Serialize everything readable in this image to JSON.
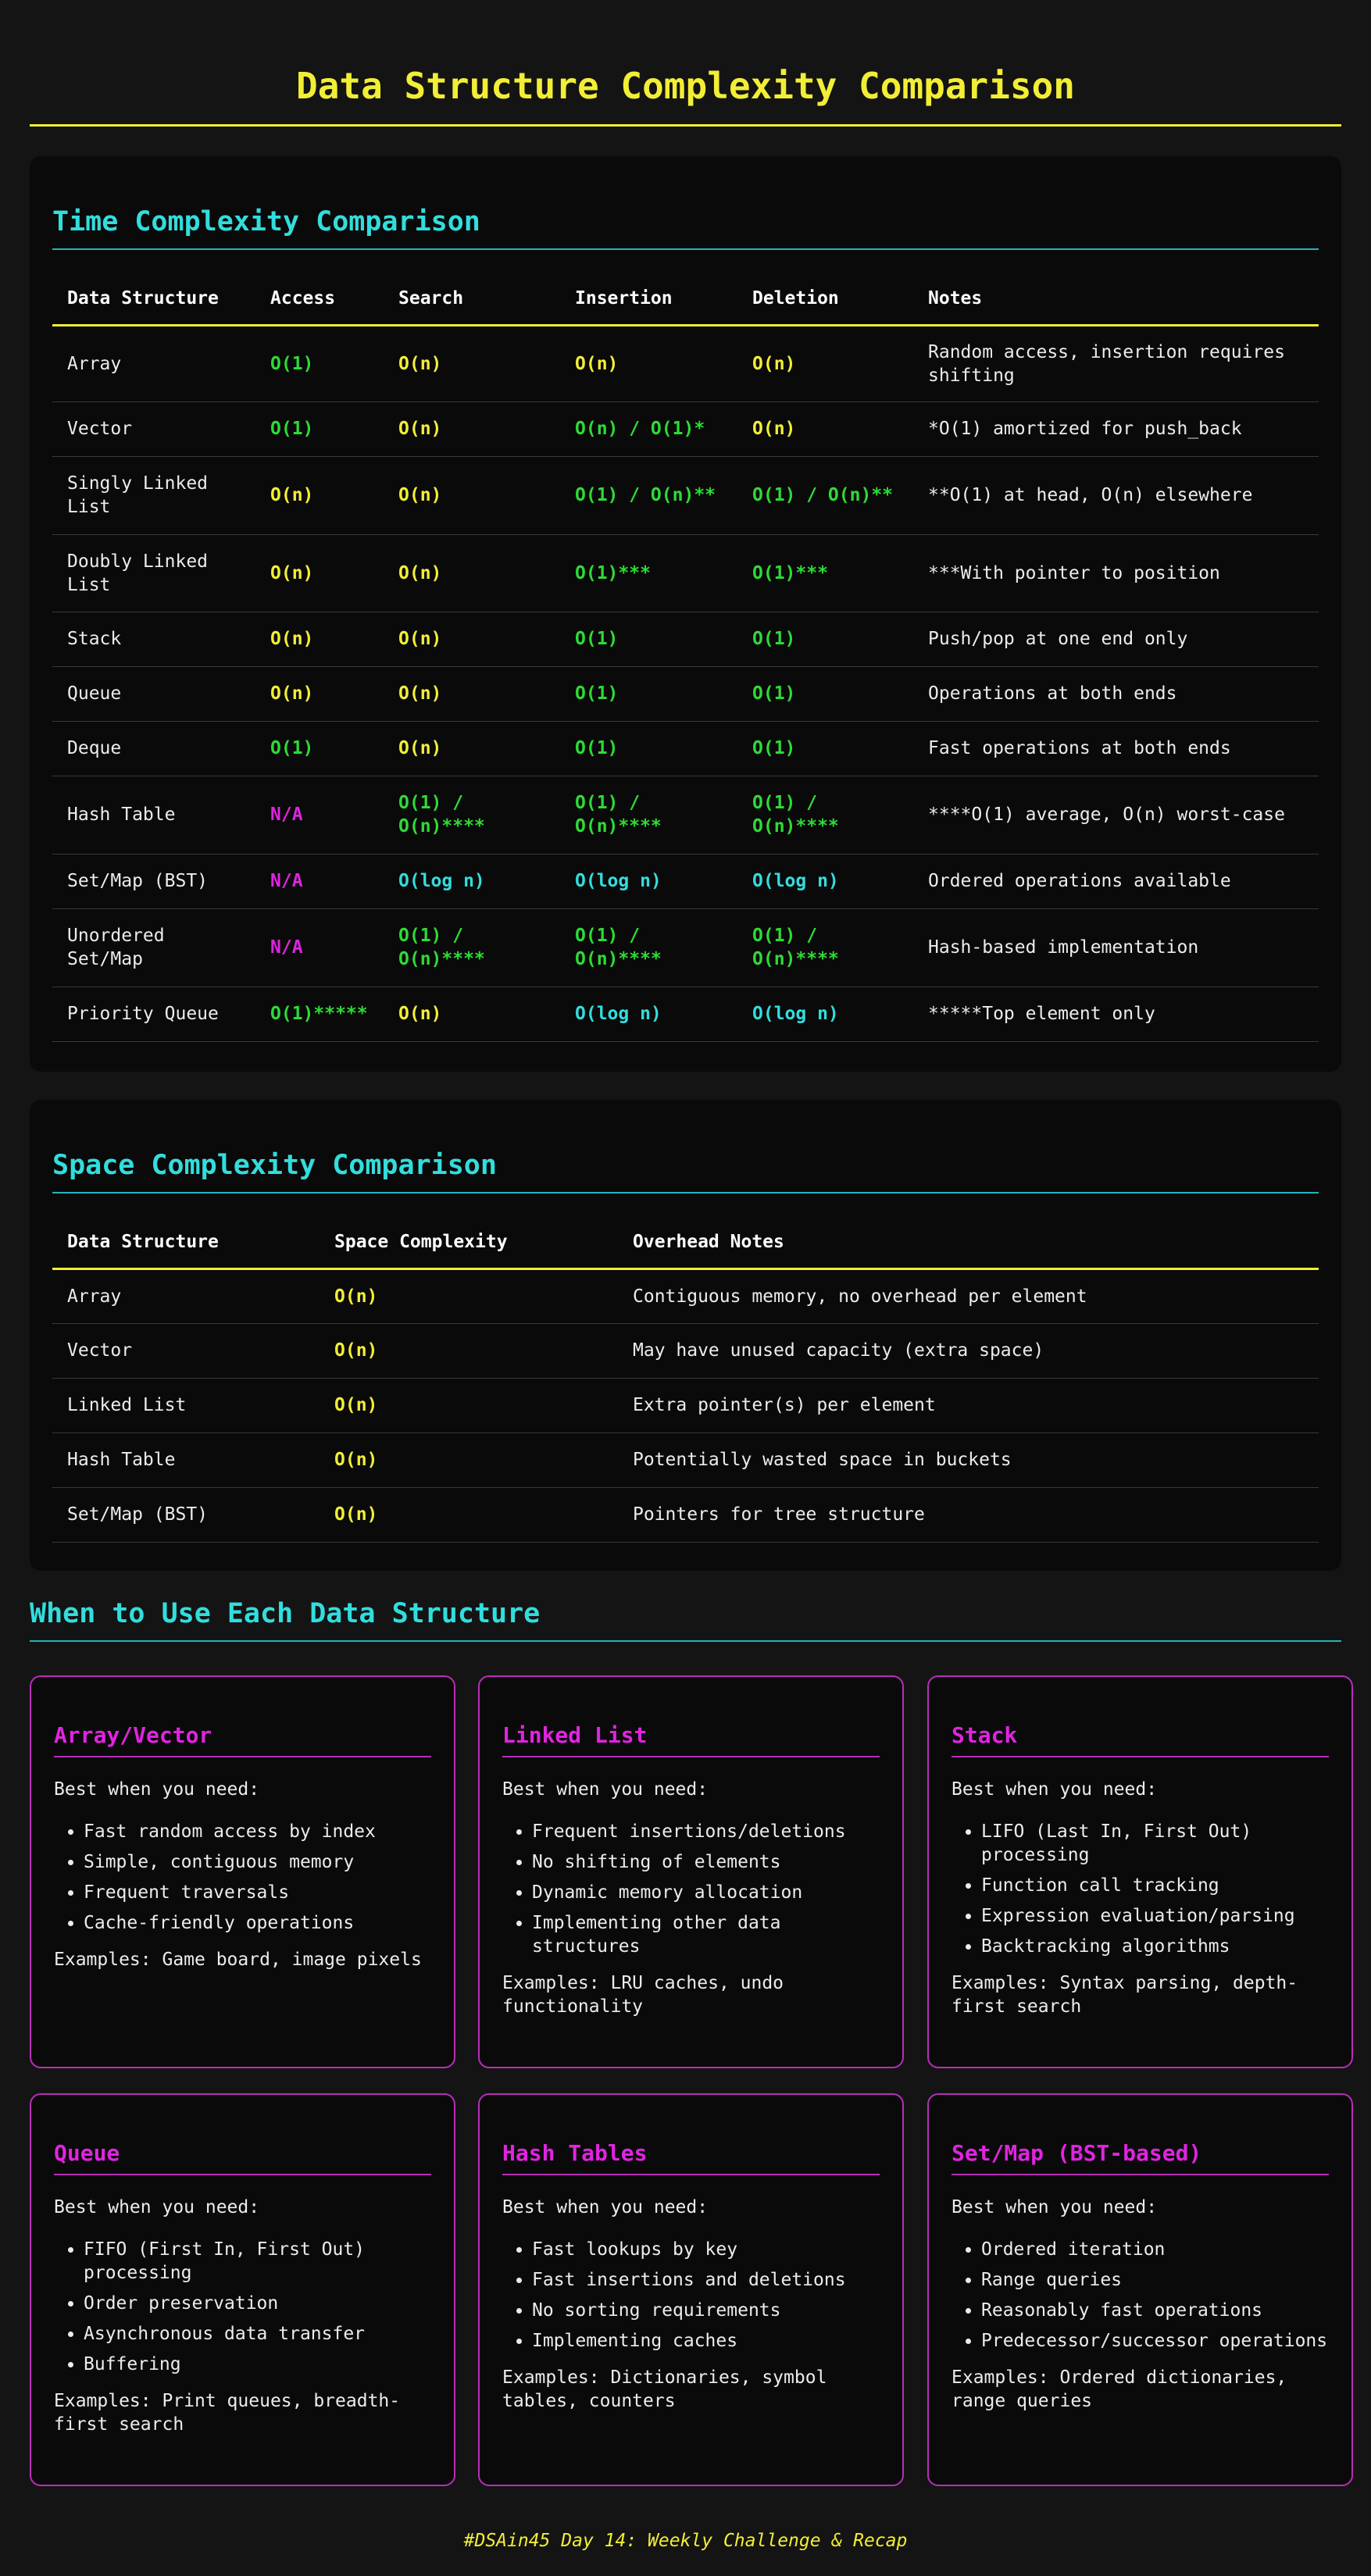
{
  "page": {
    "title": "Data Structure Complexity Comparison"
  },
  "colors": {
    "yellow": "#f2ee35",
    "cyan": "#32dddd",
    "green": "#2edb35",
    "magenta": "#e024e0",
    "background": "#141414",
    "panel": "#0a0a0a"
  },
  "time_section": {
    "title": "Time Complexity Comparison",
    "headers": [
      "Data Structure",
      "Access",
      "Search",
      "Insertion",
      "Deletion",
      "Notes"
    ],
    "rows": [
      {
        "name": "Array",
        "access": "O(1)",
        "search": "O(n)",
        "insertion": "O(n)",
        "deletion": "O(n)",
        "notes": "Random access, insertion requires shifting"
      },
      {
        "name": "Vector",
        "access": "O(1)",
        "search": "O(n)",
        "insertion": "O(n) / O(1)*",
        "deletion": "O(n)",
        "notes": "*O(1) amortized for push_back"
      },
      {
        "name": "Singly Linked List",
        "access": "O(n)",
        "search": "O(n)",
        "insertion": "O(1) / O(n)**",
        "deletion": "O(1) / O(n)**",
        "notes": "**O(1) at head, O(n) elsewhere"
      },
      {
        "name": "Doubly Linked List",
        "access": "O(n)",
        "search": "O(n)",
        "insertion": "O(1)***",
        "deletion": "O(1)***",
        "notes": "***With pointer to position"
      },
      {
        "name": "Stack",
        "access": "O(n)",
        "search": "O(n)",
        "insertion": "O(1)",
        "deletion": "O(1)",
        "notes": "Push/pop at one end only"
      },
      {
        "name": "Queue",
        "access": "O(n)",
        "search": "O(n)",
        "insertion": "O(1)",
        "deletion": "O(1)",
        "notes": "Operations at both ends"
      },
      {
        "name": "Deque",
        "access": "O(1)",
        "search": "O(n)",
        "insertion": "O(1)",
        "deletion": "O(1)",
        "notes": "Fast operations at both ends"
      },
      {
        "name": "Hash Table",
        "access": "N/A",
        "search": "O(1) / O(n)****",
        "insertion": "O(1) / O(n)****",
        "deletion": "O(1) / O(n)****",
        "notes": "****O(1) average, O(n) worst-case"
      },
      {
        "name": "Set/Map (BST)",
        "access": "N/A",
        "search": "O(log n)",
        "insertion": "O(log n)",
        "deletion": "O(log n)",
        "notes": "Ordered operations available"
      },
      {
        "name": "Unordered Set/Map",
        "access": "N/A",
        "search": "O(1) / O(n)****",
        "insertion": "O(1) / O(n)****",
        "deletion": "O(1) / O(n)****",
        "notes": "Hash-based implementation"
      },
      {
        "name": "Priority Queue",
        "access": "O(1)*****",
        "search": "O(n)",
        "insertion": "O(log n)",
        "deletion": "O(log n)",
        "notes": "*****Top element only"
      }
    ]
  },
  "space_section": {
    "title": "Space Complexity Comparison",
    "headers": [
      "Data Structure",
      "Space Complexity",
      "Overhead Notes"
    ],
    "rows": [
      {
        "name": "Array",
        "space": "O(n)",
        "notes": "Contiguous memory, no overhead per element"
      },
      {
        "name": "Vector",
        "space": "O(n)",
        "notes": "May have unused capacity (extra space)"
      },
      {
        "name": "Linked List",
        "space": "O(n)",
        "notes": "Extra pointer(s) per element"
      },
      {
        "name": "Hash Table",
        "space": "O(n)",
        "notes": "Potentially wasted space in buckets"
      },
      {
        "name": "Set/Map (BST)",
        "space": "O(n)",
        "notes": "Pointers for tree structure"
      }
    ]
  },
  "usage_section": {
    "title": "When to Use Each Data Structure",
    "cards": [
      {
        "title": "Array/Vector",
        "intro": "Best when you need:",
        "items": [
          "Fast random access by index",
          "Simple, contiguous memory",
          "Frequent traversals",
          "Cache-friendly operations"
        ],
        "examples": "Examples: Game board, image pixels"
      },
      {
        "title": "Linked List",
        "intro": "Best when you need:",
        "items": [
          "Frequent insertions/deletions",
          "No shifting of elements",
          "Dynamic memory allocation",
          "Implementing other data structures"
        ],
        "examples": "Examples: LRU caches, undo functionality"
      },
      {
        "title": "Stack",
        "intro": "Best when you need:",
        "items": [
          "LIFO (Last In, First Out) processing",
          "Function call tracking",
          "Expression evaluation/parsing",
          "Backtracking algorithms"
        ],
        "examples": "Examples: Syntax parsing, depth-first search"
      },
      {
        "title": "Queue",
        "intro": "Best when you need:",
        "items": [
          "FIFO (First In, First Out) processing",
          "Order preservation",
          "Asynchronous data transfer",
          "Buffering"
        ],
        "examples": "Examples: Print queues, breadth-first search"
      },
      {
        "title": "Hash Tables",
        "intro": "Best when you need:",
        "items": [
          "Fast lookups by key",
          "Fast insertions and deletions",
          "No sorting requirements",
          "Implementing caches"
        ],
        "examples": "Examples: Dictionaries, symbol tables, counters"
      },
      {
        "title": "Set/Map (BST-based)",
        "intro": "Best when you need:",
        "items": [
          "Ordered iteration",
          "Range queries",
          "Reasonably fast operations",
          "Predecessor/successor operations"
        ],
        "examples": "Examples: Ordered dictionaries, range queries"
      }
    ]
  },
  "footer": {
    "text": "#DSAin45 Day 14: Weekly Challenge & Recap"
  }
}
